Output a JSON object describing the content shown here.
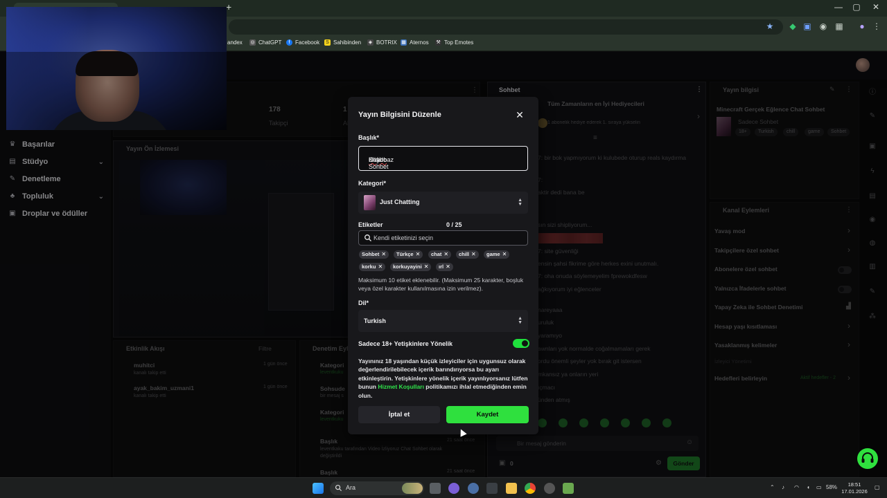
{
  "browser": {
    "bookmarks": [
      "andex",
      "ChatGPT",
      "Facebook",
      "Sahibinden",
      "BOTRIX",
      "Aternos",
      "Top Emotes"
    ]
  },
  "sidebar": {
    "items": [
      {
        "label": "Başarılar"
      },
      {
        "label": "Stüdyo"
      },
      {
        "label": "Denetleme"
      },
      {
        "label": "Topluluk"
      },
      {
        "label": "Droplar ve ödüller"
      }
    ]
  },
  "dashboard": {
    "followers_count": "178",
    "followers_label": "Takipçi",
    "stat2_count": "1",
    "stat2_label": "Ab",
    "preview_title": "Yayın Ön İzlemesi",
    "activity_title": "Etkinlik Akışı",
    "activity_filter": "Filtre",
    "activity": [
      {
        "name": "muhitci",
        "sub": "kanalı takip etti",
        "time": "1 gün önce"
      },
      {
        "name": "ayak_bakim_uzmani1",
        "sub": "kanalı takip etti",
        "time": "1 gün önce"
      }
    ],
    "mod_title": "Denetim Eyl",
    "mod_items": [
      {
        "title": "Kategori",
        "sub": "leventkuku"
      },
      {
        "title": "Sohsude",
        "sub": "bir mesaj s"
      },
      {
        "title": "Kategori",
        "sub": "leventkuku"
      },
      {
        "title": "Başlık",
        "sub": "leventkaku tarafından Video İzliyoruz Chat Sohbet olarak değiştirildi",
        "time": "21 saat önce"
      },
      {
        "title": "Başlık",
        "sub": "",
        "time": "21 saat önce"
      }
    ]
  },
  "chat": {
    "title": "Sohbet",
    "gifters_title": "Tüm Zamanların en İyi Hediyecileri",
    "gifters_sub": "1 abonelik hediye ederek 1. sıraya yükselin",
    "input_placeholder": "Bir mesaj gönderin",
    "points": "0",
    "send_label": "Gönder",
    "messages": [
      "7: bir bok yapmıyorum ki kulubede oturup reals kaydırma",
      "7:",
      "aktir dedi bana be",
      "sın sizi shipliyorum...",
      "7: site güvenliği",
      "ensin şahsi fikrime göre herkes exini unutmalı.",
      "7: oha onuda söylemeyelim fprewokdfesw",
      "ağkıyorum iyi eğlenceler",
      "nareyaaa",
      "uruluk",
      "yaramıyo",
      "awnları yok normalde coğalmamaları gerek",
      "ordu önemli şeyler yok bırak git istersen",
      "mkansız ya onların yeri",
      "ıçmacı",
      "ünden atmış"
    ]
  },
  "stream_info": {
    "title": "Yayın bilgisi",
    "stream_title": "Minecraft Gerçek Eğlence Chat Sohbet",
    "category": "Sadece Sohbet",
    "tags": [
      "18+",
      "Turkish",
      "chill",
      "game",
      "Sohbet"
    ]
  },
  "channel_actions": {
    "title": "Kanal Eylemleri",
    "items": [
      {
        "label": "Yavaş mod",
        "control": "chevron"
      },
      {
        "label": "Takipçilere özel sohbet",
        "control": "chevron"
      },
      {
        "label": "Abonelere özel sohbet",
        "control": "toggle"
      },
      {
        "label": "Yalnızca İfadelerle sohbet",
        "control": "toggle"
      },
      {
        "label": "Yapay Zeka ile Sohbet Denetimi",
        "control": "chart"
      },
      {
        "label": "Hesap yaşı kısıtlaması",
        "control": "chevron"
      },
      {
        "label": "Yasaklanmış kelimeler",
        "control": "chevron"
      }
    ],
    "muted_label": "İzleyici Yönetimi",
    "goals_label": "Hedefleri belirleyin",
    "goals_status": "Aktif hedefler - 2"
  },
  "modal": {
    "title": "Yayın Bilgisini Düzenle",
    "title_label": "Başlık*",
    "title_value_prefix": "Küfürbaz ",
    "title_value_flagged": "Haydo",
    "title_value_suffix": " Chat Sohbet",
    "category_label": "Kategori*",
    "category_value": "Just Chatting",
    "tags_label": "Etiketler",
    "tags_count": "0 / 25",
    "tags_placeholder": "Kendi etiketinizi seçin",
    "tags": [
      "Sohbet",
      "Türkçe",
      "chat",
      "chill",
      "game",
      "korku",
      "korkuyayini",
      "ırl"
    ],
    "tags_hint": "Maksimum 10 etiket eklenebilir. (Maksimum 25 karakter, boşluk veya özel karakter kullanılmasına izin verilmez).",
    "language_label": "Dil*",
    "language_value": "Turkish",
    "adult_label": "Sadece 18+ Yetişkinlere Yönelik",
    "adult_enabled": true,
    "notice_1": "Yayınınız 18 yaşından küçük izleyiciler için uygunsuz olarak değerlendirilebilecek içerik barındırıyorsa bu ayarı etkinleştirin. Yetişkinlere yönelik içerik yayınlıyorsanız lütfen bunun ",
    "notice_link": "Hizmet Koşulları",
    "notice_2": " politikamızı ihlal etmediğinden emin olun.",
    "cancel_label": "İptal et",
    "save_label": "Kaydet",
    "accent": "#2fe03e"
  },
  "taskbar": {
    "search_label": "Ara",
    "battery": "58%",
    "time": "18:51",
    "date": "17.01.2026"
  }
}
